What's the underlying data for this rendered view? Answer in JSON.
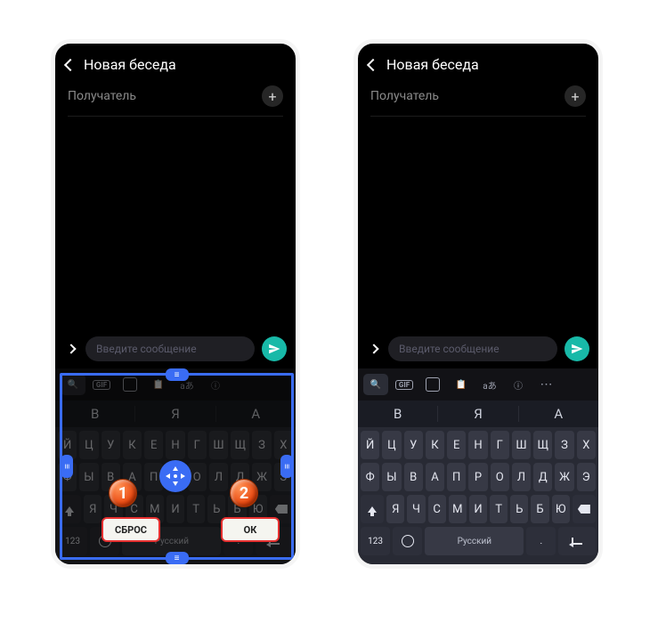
{
  "header": {
    "title": "Новая беседа"
  },
  "recipient": {
    "label": "Получатель"
  },
  "compose": {
    "placeholder": "Введите сообщение"
  },
  "suggestions": [
    "В",
    "Я",
    "А"
  ],
  "keyboard": {
    "row1": [
      "Й",
      "Ц",
      "У",
      "К",
      "Е",
      "Н",
      "Г",
      "Ш",
      "Щ",
      "З",
      "Х"
    ],
    "row2": [
      "Ф",
      "Ы",
      "В",
      "А",
      "П",
      "Р",
      "О",
      "Л",
      "Д",
      "Ж",
      "Э"
    ],
    "row3": [
      "Я",
      "Ч",
      "С",
      "М",
      "И",
      "Т",
      "Ь",
      "Б",
      "Ю"
    ],
    "fn": "123",
    "space": "Русский"
  },
  "resize": {
    "reset_label": "СБРОС",
    "ok_label": "ОК"
  },
  "badges": {
    "b1": "1",
    "b2": "2"
  }
}
